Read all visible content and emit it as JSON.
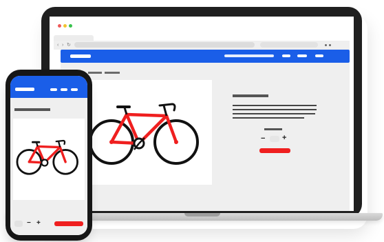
{
  "colors": {
    "accent_blue": "#1a5ee8",
    "bike_red": "#ef1f1f",
    "dark": "#1f1f1f",
    "screen_bg": "#efefef"
  },
  "icons": {
    "close": "close-dot-icon",
    "minimize": "minimize-dot-icon",
    "maximize": "maximize-dot-icon",
    "back": "chevron-left-icon",
    "forward": "chevron-right-icon",
    "reload": "reload-icon",
    "menu": "kebab-menu-icon",
    "product": "bicycle-icon",
    "minus": "minus-icon",
    "plus": "plus-icon"
  },
  "browser": {
    "back_glyph": "‹",
    "forward_glyph": "›",
    "reload_glyph": "↻"
  },
  "laptop_product": {
    "minus_label": "−",
    "plus_label": "+"
  },
  "phone_product": {
    "minus_label": "−",
    "plus_label": "+"
  }
}
